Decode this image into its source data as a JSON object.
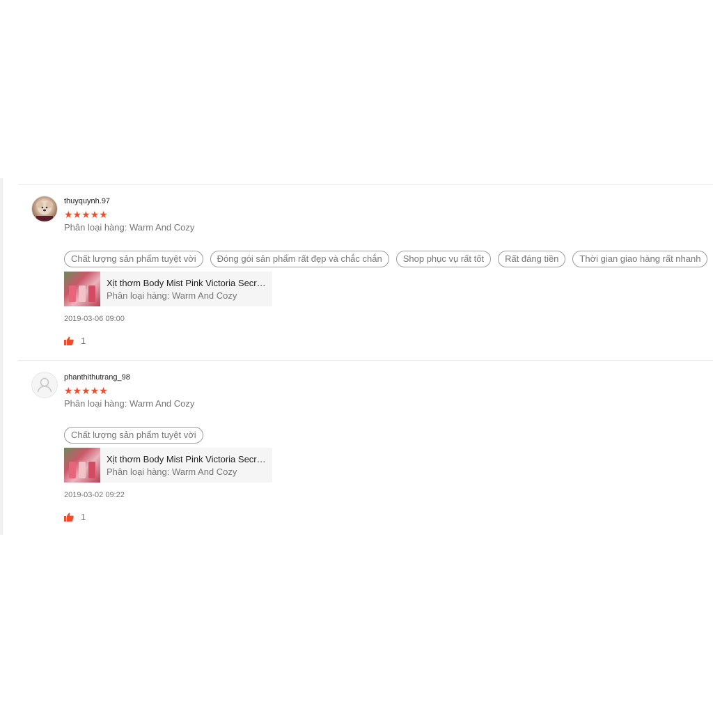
{
  "reviews": [
    {
      "username": "thuyquynh.97",
      "rating": 5,
      "stars": "★★★★★",
      "variation": "Phân loại hàng: Warm And Cozy",
      "tags": [
        "Chất lượng sản phẩm tuyệt vời",
        "Đóng gói sản phẩm rất đẹp và chắc chắn",
        "Shop phục vụ rất tốt",
        "Rất đáng tiền",
        "Thời gian giao hàng rất nhanh"
      ],
      "product": {
        "title": "Xịt thơm Body Mist Pink Victoria Secret Chính Hãng",
        "variation": "Phân loại hàng: Warm And Cozy"
      },
      "time": "2019-03-06 09:00",
      "likes": "1"
    },
    {
      "username": "phanthithutrang_98",
      "rating": 5,
      "stars": "★★★★★",
      "variation": "Phân loại hàng: Warm And Cozy",
      "tags": [
        "Chất lượng sản phẩm tuyệt vời"
      ],
      "product": {
        "title": "Xịt thơm Body Mist Pink Victoria Secret Chính Hãng",
        "variation": "Phân loại hàng: Warm And Cozy"
      },
      "time": "2019-03-02 09:22",
      "likes": "1"
    }
  ],
  "colors": {
    "accent": "#ee4d2d",
    "muted": "#757575"
  },
  "icons": {
    "like": "thumbs-up-icon",
    "default_avatar": "user-icon"
  }
}
